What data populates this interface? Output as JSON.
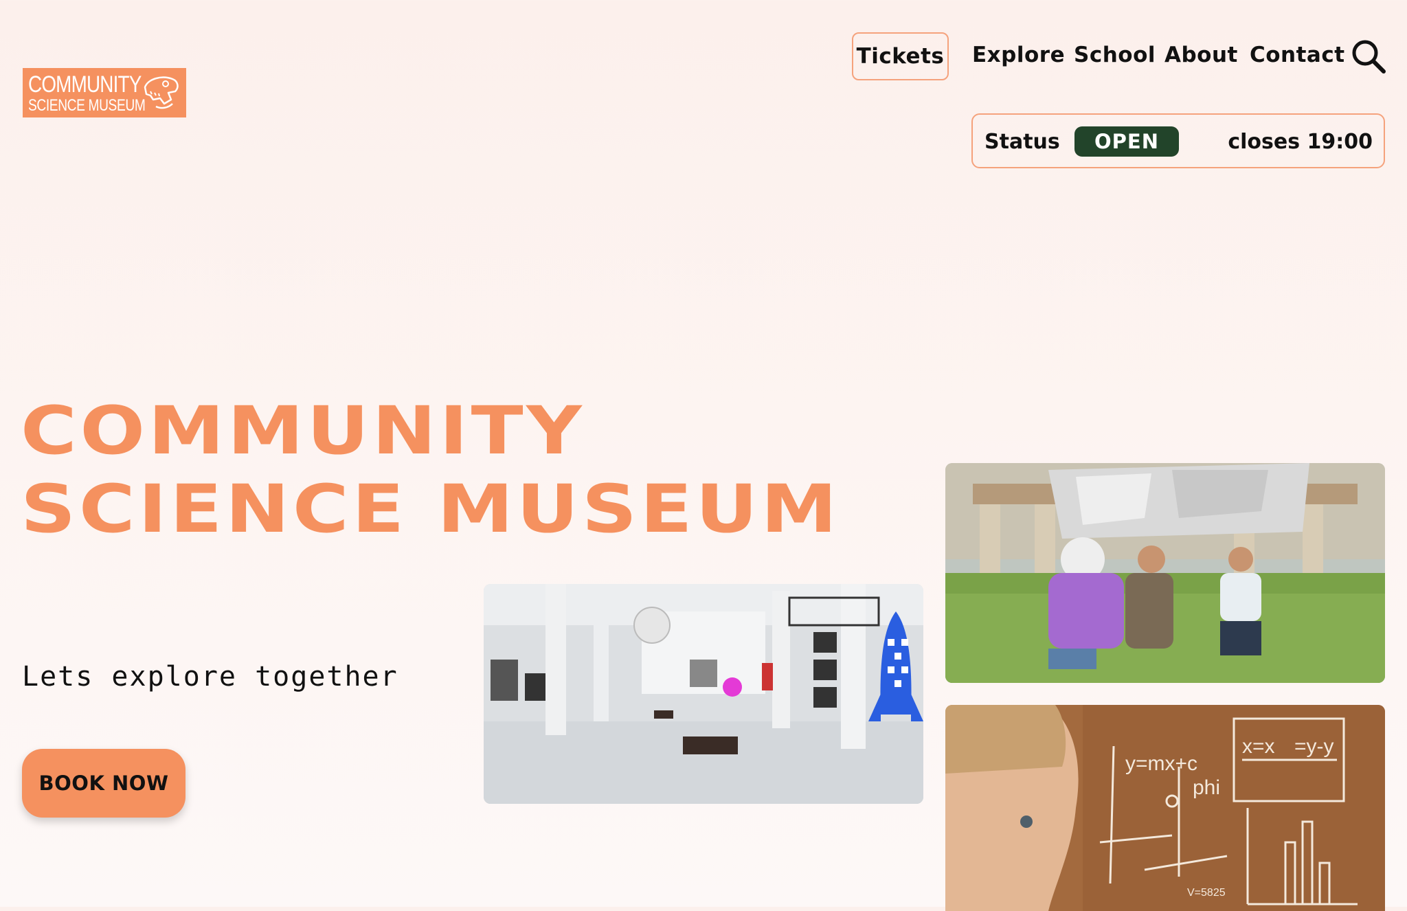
{
  "logo": {
    "line1": "COMMUNITY",
    "line2": "SCIENCE MUSEUM",
    "icon": "dinosaur-skull-icon"
  },
  "nav": {
    "tickets": "Tickets",
    "explore": "Explore",
    "school": "School",
    "about": "About",
    "contact": "Contact",
    "search_icon": "search-icon"
  },
  "status": {
    "label": "Status",
    "state": "OPEN",
    "closes": "closes 19:00"
  },
  "hero": {
    "title_line1": "COMMUNITY",
    "title_line2": "SCIENCE MUSEUM",
    "tagline": "Lets explore together",
    "cta": "BOOK NOW"
  },
  "chalkboard": {
    "eq1": "y=mx+c",
    "phi": "phi",
    "readout": "V=5825"
  },
  "colors": {
    "accent": "#f5915f",
    "status_open": "#22442a",
    "background": "#fdf4f1"
  }
}
